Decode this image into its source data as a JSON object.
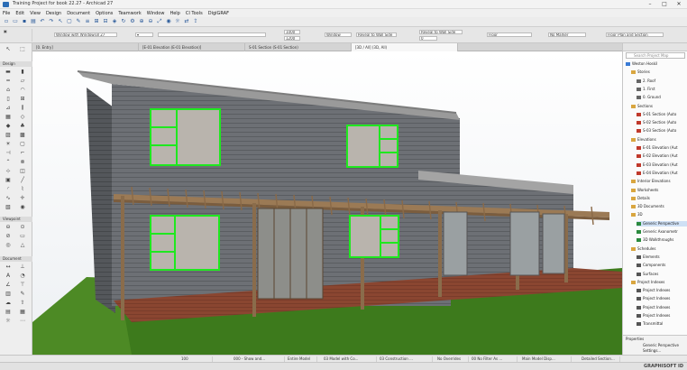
{
  "window": {
    "title": "Training Project for book 22.27 - Archicad 27",
    "minimize": "–",
    "maximize": "□",
    "close": "✕"
  },
  "menu": [
    "File",
    "Edit",
    "View",
    "Design",
    "Document",
    "Options",
    "Teamwork",
    "Window",
    "Help",
    "CI Tools",
    "DigiGRAF"
  ],
  "infobox": {
    "layer_combo": "Window with Windowsill 27",
    "height_value": "1000",
    "height2_value": "1200",
    "anchor": "Window",
    "reveal": "Reveal to Wall Side",
    "width_label": "0",
    "floor": "Floor",
    "no_marker": "No Marker",
    "display": "Floor Plan and Section"
  },
  "tabs": [
    {
      "label": "[0. Entry]",
      "active": false
    },
    {
      "label": "[E-01 Elevation (E-01 Elevation)]",
      "active": false
    },
    {
      "label": "S-01 Section (S-01 Section)",
      "active": false
    },
    {
      "label": "[3D / All] (3D, All)",
      "active": true
    }
  ],
  "toolbox": {
    "sections": [
      "Design",
      "Viewpoint",
      "Document"
    ]
  },
  "navigator": {
    "search_placeholder": "Search Project Map",
    "items": [
      {
        "label": "Weston Hoskil",
        "depth": 0,
        "icon": "project"
      },
      {
        "label": "Stories",
        "depth": 1,
        "icon": "folder"
      },
      {
        "label": "2. Roof",
        "depth": 2,
        "icon": "story"
      },
      {
        "label": "1. First",
        "depth": 2,
        "icon": "story"
      },
      {
        "label": "0. Ground",
        "depth": 2,
        "icon": "story"
      },
      {
        "label": "Sections",
        "depth": 1,
        "icon": "folder"
      },
      {
        "label": "S-01 Section (Auto",
        "depth": 2,
        "icon": "section"
      },
      {
        "label": "S-02 Section (Auto",
        "depth": 2,
        "icon": "section"
      },
      {
        "label": "S-03 Section (Auto",
        "depth": 2,
        "icon": "section"
      },
      {
        "label": "Elevations",
        "depth": 1,
        "icon": "folder"
      },
      {
        "label": "E-01 Elevation (Aut",
        "depth": 2,
        "icon": "elevation"
      },
      {
        "label": "E-02 Elevation (Aut",
        "depth": 2,
        "icon": "elevation"
      },
      {
        "label": "E-03 Elevation (Aut",
        "depth": 2,
        "icon": "elevation"
      },
      {
        "label": "E-04 Elevation (Aut",
        "depth": 2,
        "icon": "elevation"
      },
      {
        "label": "Interior Elevations",
        "depth": 1,
        "icon": "folder"
      },
      {
        "label": "Worksheets",
        "depth": 1,
        "icon": "folder"
      },
      {
        "label": "Details",
        "depth": 1,
        "icon": "folder"
      },
      {
        "label": "3D Documents",
        "depth": 1,
        "icon": "folder"
      },
      {
        "label": "3D",
        "depth": 1,
        "icon": "folder"
      },
      {
        "label": "Generic Perspective",
        "depth": 2,
        "icon": "perspective",
        "selected": true
      },
      {
        "label": "Generic Axonometr",
        "depth": 2,
        "icon": "axon"
      },
      {
        "label": "3D Walkthroughs",
        "depth": 2,
        "icon": "axon"
      },
      {
        "label": "Schedules",
        "depth": 1,
        "icon": "folder"
      },
      {
        "label": "Elements",
        "depth": 2,
        "icon": "schedule"
      },
      {
        "label": "Components",
        "depth": 2,
        "icon": "schedule"
      },
      {
        "label": "Surfaces",
        "depth": 2,
        "icon": "schedule"
      },
      {
        "label": "Project Indexes",
        "depth": 1,
        "icon": "folder"
      },
      {
        "label": "Project Indexes",
        "depth": 2,
        "icon": "index"
      },
      {
        "label": "Project Indexes",
        "depth": 2,
        "icon": "index"
      },
      {
        "label": "Project Indexes",
        "depth": 2,
        "icon": "index"
      },
      {
        "label": "Project Indexes",
        "depth": 2,
        "icon": "index"
      },
      {
        "label": "Transmittal",
        "depth": 2,
        "icon": "index"
      }
    ],
    "props_title": "Properties",
    "props_value": "Generic Perspective",
    "props_settings": "Settings..."
  },
  "statusbar": {
    "zoom": "100",
    "layer_combo": "000 - Show and...",
    "model_view": "Entire Model",
    "pen_set": "03 Model with Co...",
    "mvo": "03 Construction ...",
    "overrides": "No Overrides",
    "renovation": "00 No Filter As ...",
    "structure": "Main Model Disp...",
    "detail": "Detailed Section..."
  },
  "bottombar": {
    "brand": "GRAPHISOFT ID"
  },
  "colors": {
    "window_frame": "#1fe81f",
    "siding": "#6f7276",
    "deck": "#8a4a33",
    "grass": "#3f7a1e",
    "sky_top": "#ffffff",
    "sky_bottom": "#eef1f4"
  }
}
